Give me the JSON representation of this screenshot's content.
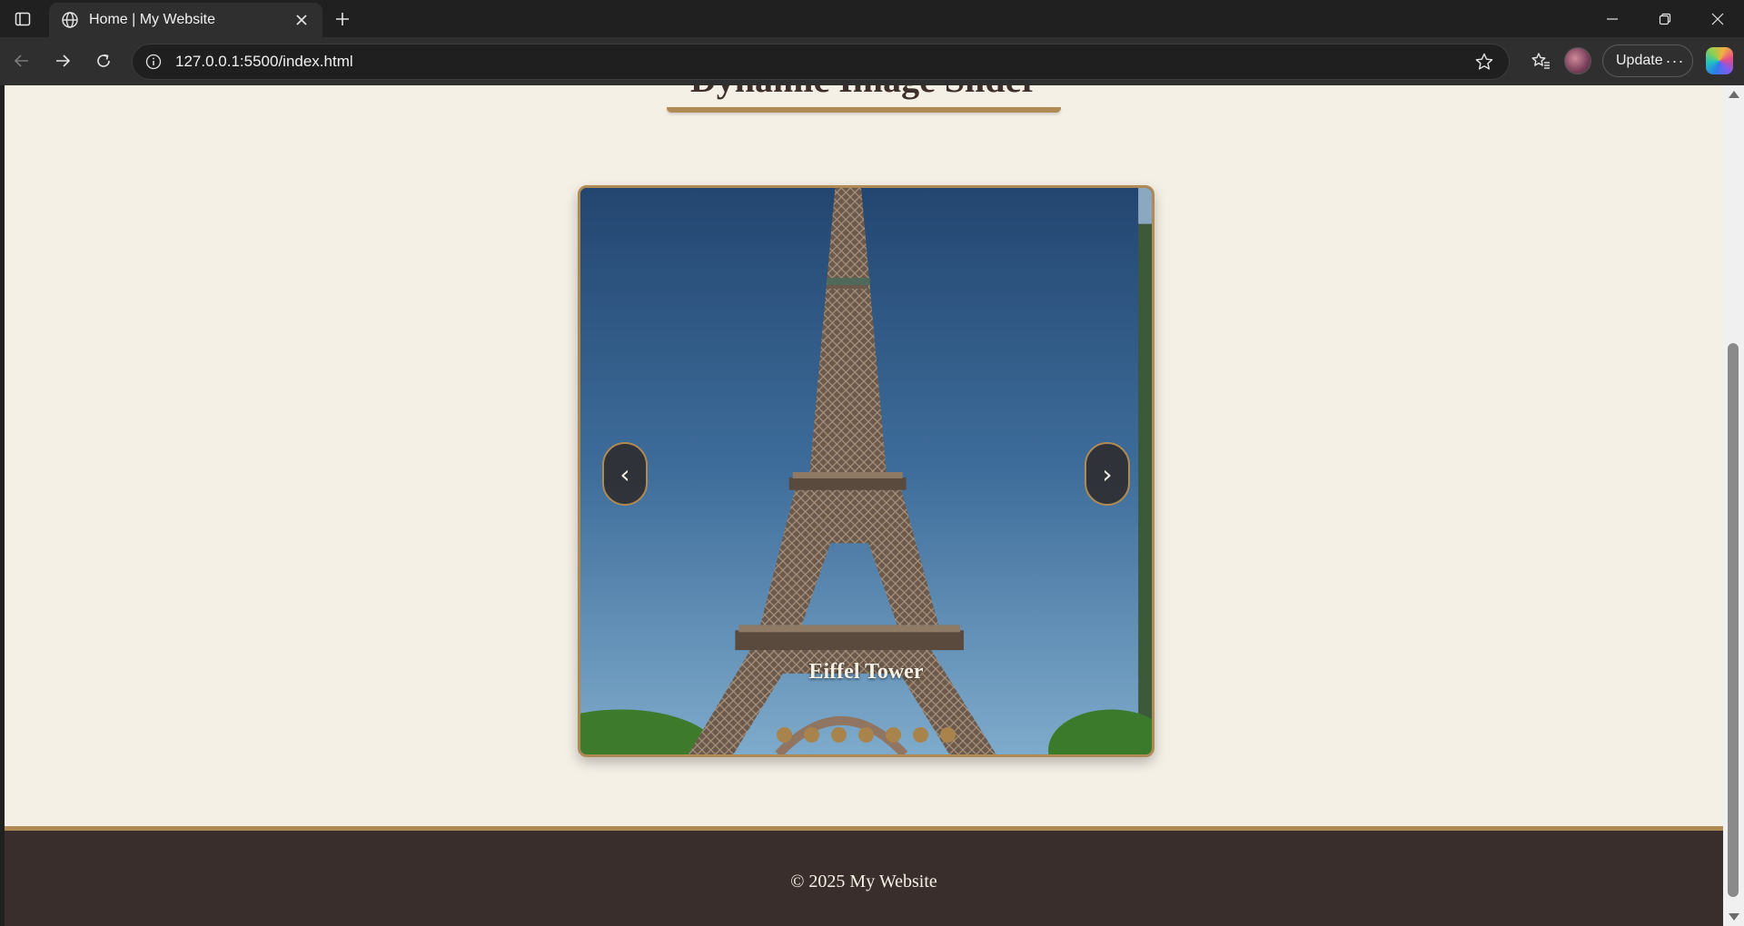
{
  "browser": {
    "tab_title": "Home | My Website",
    "url": "127.0.0.1:5500/index.html",
    "update_label": "Update",
    "more_icon_text": "···"
  },
  "page": {
    "heading": "Dynamic Image Slider",
    "slider": {
      "prev_label": "‹",
      "next_label": "›",
      "caption": "Eiffel Tower",
      "dots_count": 7
    },
    "footer_text": "© 2025 My Website"
  },
  "colors": {
    "accent": "#b08a55",
    "page_bg": "#f5f0e6",
    "footer_bg": "#3a2e2c"
  }
}
